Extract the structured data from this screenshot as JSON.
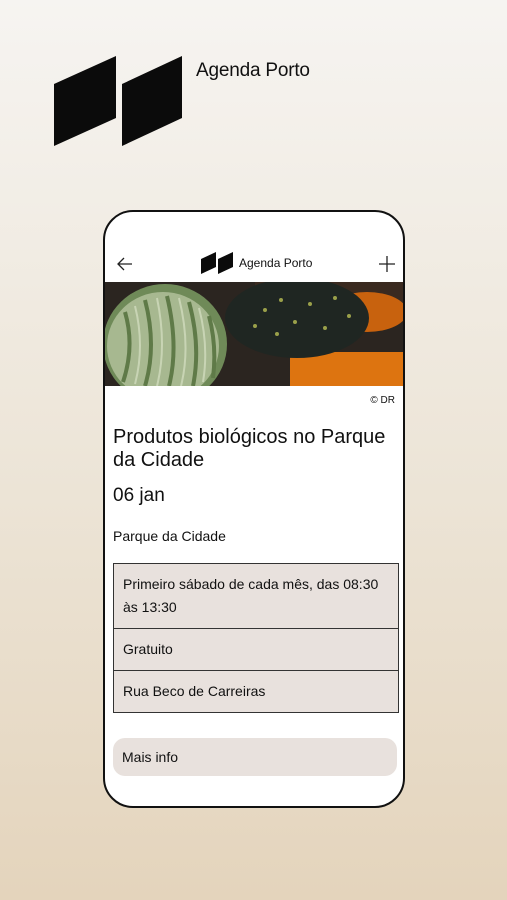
{
  "app": {
    "name": "Agenda Porto"
  },
  "header": {
    "back_icon": "arrow-left-icon",
    "add_icon": "plus-icon",
    "title": "Agenda Porto"
  },
  "event": {
    "photo_credit": "© DR",
    "title": "Produtos biológicos no Parque da Cidade",
    "date": "06 jan",
    "place": "Parque da Cidade",
    "details": [
      "Primeiro sábado de cada mês, das 08:30 às 13:30",
      "Gratuito",
      "Rua Beco de Carreiras"
    ],
    "more_info": "Mais info"
  },
  "colors": {
    "background_top": "#f6f4f1",
    "background_bottom": "#e4d4bc",
    "panel": "#e8e1dd",
    "ink": "#111111"
  }
}
